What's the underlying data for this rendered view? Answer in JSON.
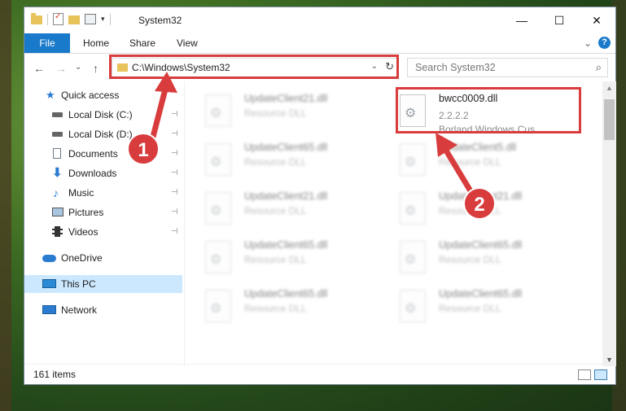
{
  "window": {
    "title": "System32",
    "controls": {
      "minimize": "—",
      "maximize": "☐",
      "close": "✕"
    }
  },
  "ribbon": {
    "tabs": [
      {
        "label": "File"
      },
      {
        "label": "Home"
      },
      {
        "label": "Share"
      },
      {
        "label": "View"
      }
    ],
    "collapse_glyph": "⌄",
    "help_label": "?"
  },
  "nav": {
    "back": "←",
    "forward": "→",
    "recent": "⌄",
    "up": "↑",
    "address": "C:\\Windows\\System32",
    "address_dropdown": "⌄",
    "refresh": "↻",
    "search_placeholder": "Search System32",
    "search_icon": "⌕"
  },
  "sidebar": {
    "items": [
      {
        "label": "Quick access",
        "icon": "star-icon",
        "color": "#2b7bd1"
      },
      {
        "label": "Local Disk (C:)",
        "icon": "drive-icon",
        "color": "#555555",
        "pinned": true
      },
      {
        "label": "Local Disk (D:)",
        "icon": "drive-icon",
        "color": "#555555",
        "pinned": true
      },
      {
        "label": "Documents",
        "icon": "document-icon",
        "color": "#6d7b8a",
        "pinned": true
      },
      {
        "label": "Downloads",
        "icon": "download-icon",
        "color": "#2b7bd1",
        "pinned": true
      },
      {
        "label": "Music",
        "icon": "music-icon",
        "color": "#2b7bd1",
        "pinned": true
      },
      {
        "label": "Pictures",
        "icon": "pictures-icon",
        "color": "#6d8fb0",
        "pinned": true
      },
      {
        "label": "Videos",
        "icon": "videos-icon",
        "color": "#555555",
        "pinned": true
      },
      {
        "label": "OneDrive",
        "icon": "cloud-icon",
        "color": "#2b7bd1"
      },
      {
        "label": "This PC",
        "icon": "pc-icon",
        "color": "#2b8ad6",
        "selected": true
      },
      {
        "label": "Network",
        "icon": "network-icon",
        "color": "#2b7bd1"
      }
    ],
    "pin_glyph": "📌"
  },
  "files": [
    {
      "name": "UpdateClient21.dll",
      "type": "Resource DLL",
      "blurred": true
    },
    {
      "name": "bwcc0009.dll",
      "type": "2.2.2.2",
      "desc": "Borland Windows Cus...",
      "blurred": false
    },
    {
      "name": "UpdateClient65.dll",
      "type": "Resource DLL",
      "blurred": true
    },
    {
      "name": "UpdateClient5.dll",
      "type": "Resource DLL",
      "blurred": true
    },
    {
      "name": "UpdateClient21.dll",
      "type": "Resource DLL",
      "blurred": true
    },
    {
      "name": "UpdateClient21.dll",
      "type": "Resource DLL",
      "blurred": true
    },
    {
      "name": "UpdateClient65.dll",
      "type": "Resource DLL",
      "blurred": true
    },
    {
      "name": "UpdateClient65.dll",
      "type": "Resource DLL",
      "blurred": true
    },
    {
      "name": "UpdateClient65.dll",
      "type": "Resource DLL",
      "blurred": true
    },
    {
      "name": "UpdateClient65.dll",
      "type": "Resource DLL",
      "blurred": true
    }
  ],
  "status": {
    "item_count": "161 items"
  },
  "annotations": {
    "badge1": "1",
    "badge2": "2",
    "color": "#d83c3c"
  }
}
